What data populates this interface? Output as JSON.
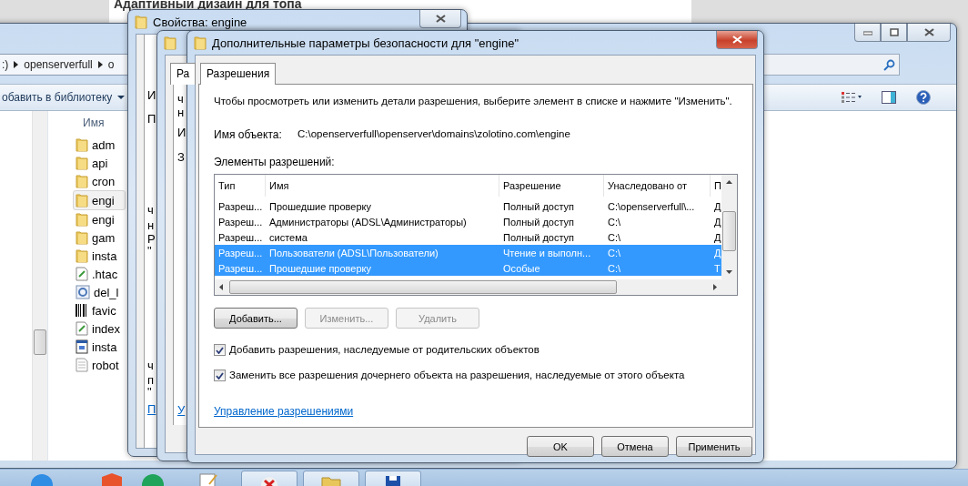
{
  "browser_page": {
    "heading": "Адаптивный дизайн для топа"
  },
  "explorer": {
    "breadcrumb": [
      ":)",
      "openserverfull",
      "o"
    ],
    "library_button": "обавить в библиотеку",
    "column_header": "Имя",
    "files": [
      {
        "name": "adm",
        "kind": "folder",
        "selected": false
      },
      {
        "name": "api",
        "kind": "folder",
        "selected": false
      },
      {
        "name": "cron",
        "kind": "folder",
        "selected": false
      },
      {
        "name": "engi",
        "kind": "folder",
        "selected": true
      },
      {
        "name": "engi",
        "kind": "folder",
        "selected": false
      },
      {
        "name": "gam",
        "kind": "folder",
        "selected": false
      },
      {
        "name": "insta",
        "kind": "folder",
        "selected": false
      },
      {
        "name": ".htac",
        "kind": "script",
        "selected": false
      },
      {
        "name": "del_l",
        "kind": "config",
        "selected": false
      },
      {
        "name": "favic",
        "kind": "barcode",
        "selected": false
      },
      {
        "name": "index",
        "kind": "script",
        "selected": false
      },
      {
        "name": "insta",
        "kind": "app",
        "selected": false
      },
      {
        "name": "robot",
        "kind": "text",
        "selected": false
      }
    ]
  },
  "properties_window": {
    "title": "Свойства: engine",
    "fragments": [
      {
        "text": "И",
        "kind": "text"
      },
      {
        "text": "П",
        "kind": "text"
      },
      {
        "text": "ч",
        "kind": "text"
      },
      {
        "text": "н",
        "kind": "text"
      },
      {
        "text": "Р",
        "kind": "text"
      },
      {
        "text": "\"",
        "kind": "text"
      },
      {
        "text": "ч",
        "kind": "text"
      },
      {
        "text": "п",
        "kind": "text"
      },
      {
        "text": "\"",
        "kind": "text"
      },
      {
        "text": "П",
        "kind": "link"
      }
    ]
  },
  "middle_window": {
    "tab": "Ра",
    "fragments": [
      {
        "text": "ч",
        "kind": "text"
      },
      {
        "text": "н",
        "kind": "text"
      },
      {
        "text": "И",
        "kind": "text"
      },
      {
        "text": "З",
        "kind": "text"
      },
      {
        "text": "У",
        "kind": "link"
      }
    ]
  },
  "dialog": {
    "title": "Дополнительные параметры безопасности  для \"engine\"",
    "tabs": [
      {
        "label": "Разрешения",
        "selected": true
      }
    ],
    "instruction": "Чтобы просмотреть или изменить детали разрешения, выберите элемент в списке и нажмите \"Изменить\".",
    "object_label": "Имя объекта:",
    "object_path": "C:\\openserverfull\\openserver\\domains\\zolotino.com\\engine",
    "list_label": "Элементы разрешений:",
    "table": {
      "columns": [
        "Тип",
        "Имя",
        "Разрешение",
        "Унаследовано от",
        "П"
      ],
      "rows": [
        {
          "cells": [
            "Разреш...",
            "Прошедшие проверку",
            "Полный доступ",
            "C:\\openserverfull\\...",
            "Д"
          ],
          "selected": false
        },
        {
          "cells": [
            "Разреш...",
            "Администраторы (ADSL\\Администраторы)",
            "Полный доступ",
            "C:\\",
            "Д"
          ],
          "selected": false
        },
        {
          "cells": [
            "Разреш...",
            "система",
            "Полный доступ",
            "C:\\",
            "Д"
          ],
          "selected": false
        },
        {
          "cells": [
            "Разреш...",
            "Пользователи (ADSL\\Пользователи)",
            "Чтение и выполн...",
            "C:\\",
            "Д"
          ],
          "selected": true
        },
        {
          "cells": [
            "Разреш...",
            "Прошедшие проверку",
            "Особые",
            "C:\\",
            "Т"
          ],
          "selected": true
        }
      ]
    },
    "actions": [
      {
        "label": "Добавить...",
        "disabled": false
      },
      {
        "label": "Изменить...",
        "disabled": true
      },
      {
        "label": "Удалить",
        "disabled": true
      }
    ],
    "checkboxes": [
      {
        "label": "Добавить разрешения, наследуемые от родительских объектов",
        "checked": true
      },
      {
        "label": "Заменить все разрешения дочернего объекта на разрешения, наследуемые от этого объекта",
        "checked": true
      }
    ],
    "link": "Управление разрешениями",
    "buttons": [
      "OK",
      "Отмена",
      "Применить"
    ]
  }
}
